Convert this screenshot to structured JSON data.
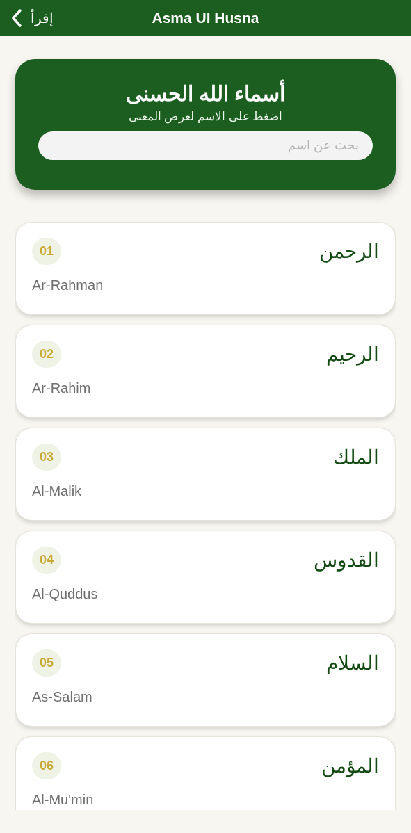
{
  "header": {
    "back_label": "إقرأ",
    "title": "Asma Ul Husna"
  },
  "hero": {
    "title": "أسماء الله الحسنى",
    "subtitle": "اضغط على الاسم لعرض المعنى",
    "search": {
      "placeholder": "بحث عن اسم"
    }
  },
  "names": [
    {
      "number": "01",
      "arabic": "الرحمن",
      "transliteration": "Ar-Rahman"
    },
    {
      "number": "02",
      "arabic": "الرحيم",
      "transliteration": "Ar-Rahim"
    },
    {
      "number": "03",
      "arabic": "الملك",
      "transliteration": "Al-Malik"
    },
    {
      "number": "04",
      "arabic": "القدوس",
      "transliteration": "Al-Quddus"
    },
    {
      "number": "05",
      "arabic": "السلام",
      "transliteration": "As-Salam"
    },
    {
      "number": "06",
      "arabic": "المؤمن",
      "transliteration": "Al-Mu'min"
    }
  ]
}
